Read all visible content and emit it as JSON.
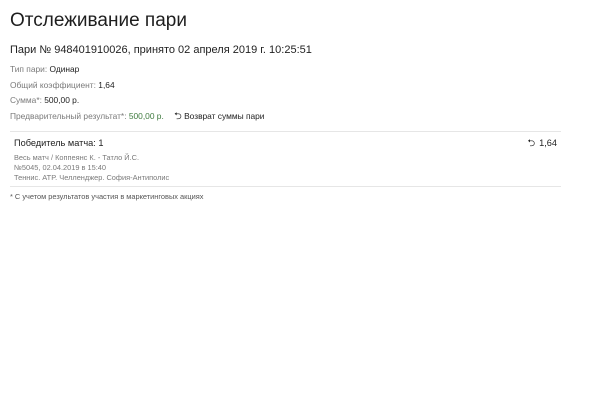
{
  "page": {
    "title": "Отслеживание пари",
    "bet_heading": "Пари № 948401910026, принято 02 апреля 2019 г. 10:25:51"
  },
  "details": {
    "bet_type_label": "Тип пари:",
    "bet_type_value": "Одинар",
    "total_coef_label": "Общий коэффициент:",
    "total_coef_value": "1,64",
    "amount_label": "Сумма*:",
    "amount_value": "500,00 р.",
    "prelim_label": "Предварительный результат*:",
    "prelim_value": "500,00 р.",
    "refund_icon": "undo-arrow-icon",
    "refund_label": "Возврат суммы пари"
  },
  "event": {
    "outcome": "Победитель матча: 1",
    "odds_icon": "undo-arrow-icon",
    "odds": "1,64",
    "match": "Весь матч / Коппеянс К. - Татло Й.С.",
    "number_date": "№5045, 02.04.2019 в 15:40",
    "tournament": "Теннис. ATP. Челленджер. София-Антиполис"
  },
  "footnote": "* С учетом результатов участия в маркетинговых акциях",
  "colors": {
    "prelim_value": "#3e7a3e",
    "label": "#7a7a7a",
    "divider": "#e6e6e6"
  }
}
